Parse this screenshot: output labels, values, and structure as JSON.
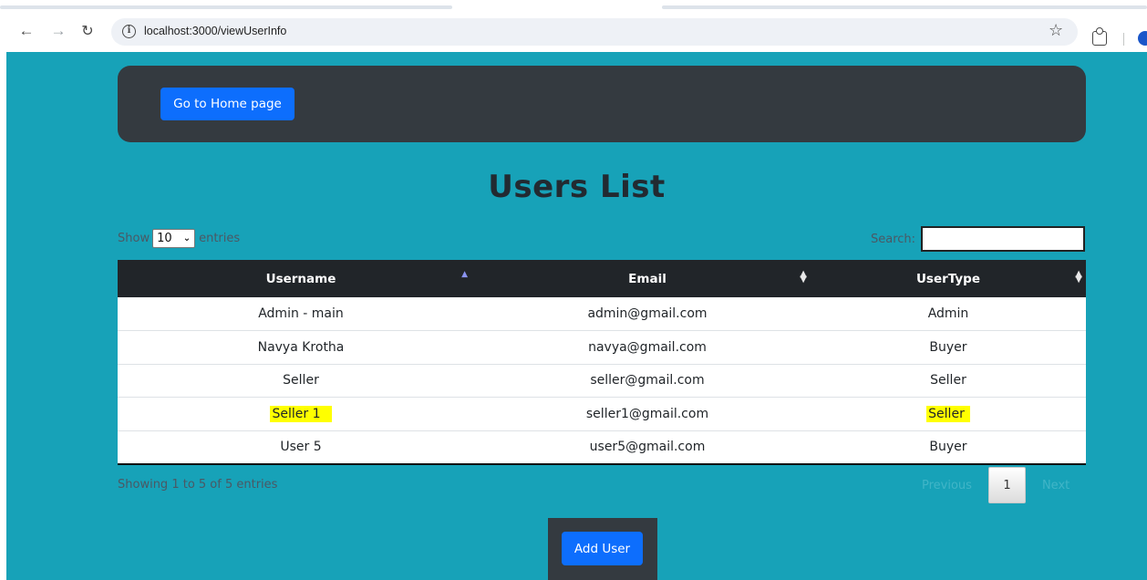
{
  "browser": {
    "url": "localhost:3000/viewUserInfo"
  },
  "navbar": {
    "home_button": "Go to Home page"
  },
  "page_title": "Users List",
  "table_controls": {
    "show_label": "Show",
    "page_length": "10",
    "entries_label": "entries",
    "search_label": "Search:",
    "search_value": ""
  },
  "table": {
    "columns": [
      "Username",
      "Email",
      "UserType"
    ],
    "rows": [
      {
        "username": "Admin - main",
        "email": "admin@gmail.com",
        "usertype": "Admin"
      },
      {
        "username": "Navya Krotha",
        "email": "navya@gmail.com",
        "usertype": "Buyer"
      },
      {
        "username": "Seller",
        "email": "seller@gmail.com",
        "usertype": "Seller"
      },
      {
        "username": "Seller 1",
        "email": "seller1@gmail.com",
        "usertype": "Seller"
      },
      {
        "username": "User 5",
        "email": "user5@gmail.com",
        "usertype": "Buyer"
      }
    ]
  },
  "footer": {
    "info": "Showing 1 to 5 of 5 entries",
    "previous": "Previous",
    "current_page": "1",
    "next": "Next"
  },
  "add_user_button": "Add User",
  "colors": {
    "page_background": "#17a2b8",
    "navbar": "#343a40",
    "primary_button": "#0d6efd",
    "table_header": "#212529",
    "highlight": "#ffff00"
  }
}
